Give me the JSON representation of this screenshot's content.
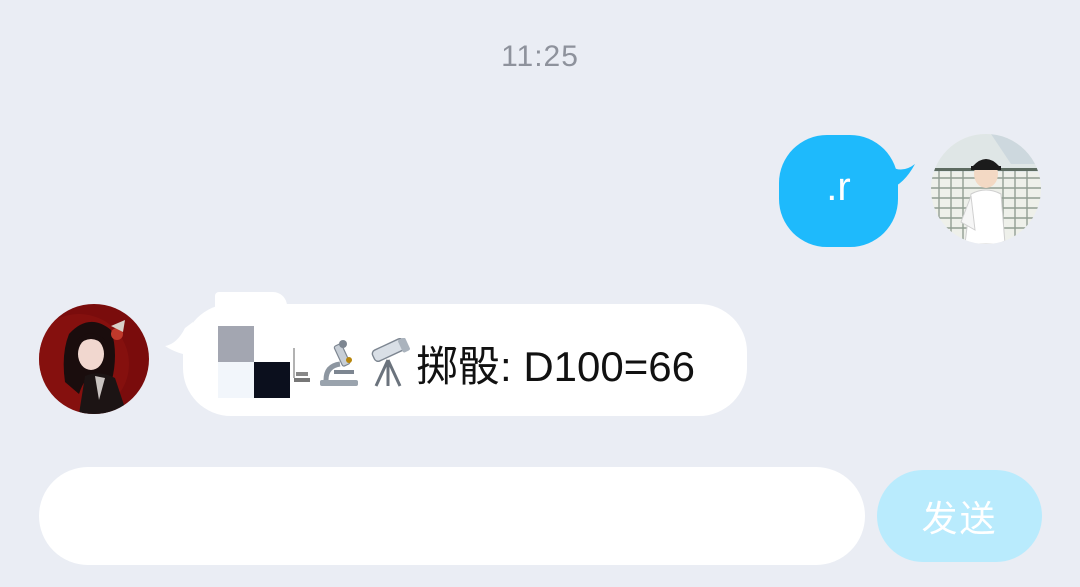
{
  "chat": {
    "timestamp": "11:25",
    "messages": [
      {
        "direction": "outgoing",
        "text": ".r",
        "bubble_color": "#1ebafc"
      },
      {
        "direction": "incoming",
        "icons": [
          "microscope-icon",
          "microscope-icon",
          "telescope-icon"
        ],
        "text": "掷骰: D100=66",
        "bubble_color": "#ffffff"
      }
    ]
  },
  "composer": {
    "input_value": "",
    "placeholder": "",
    "send_label": "发送",
    "send_color": "#b9ebfd"
  },
  "colors": {
    "background": "#eaedf4",
    "timestamp": "#8e929c"
  }
}
